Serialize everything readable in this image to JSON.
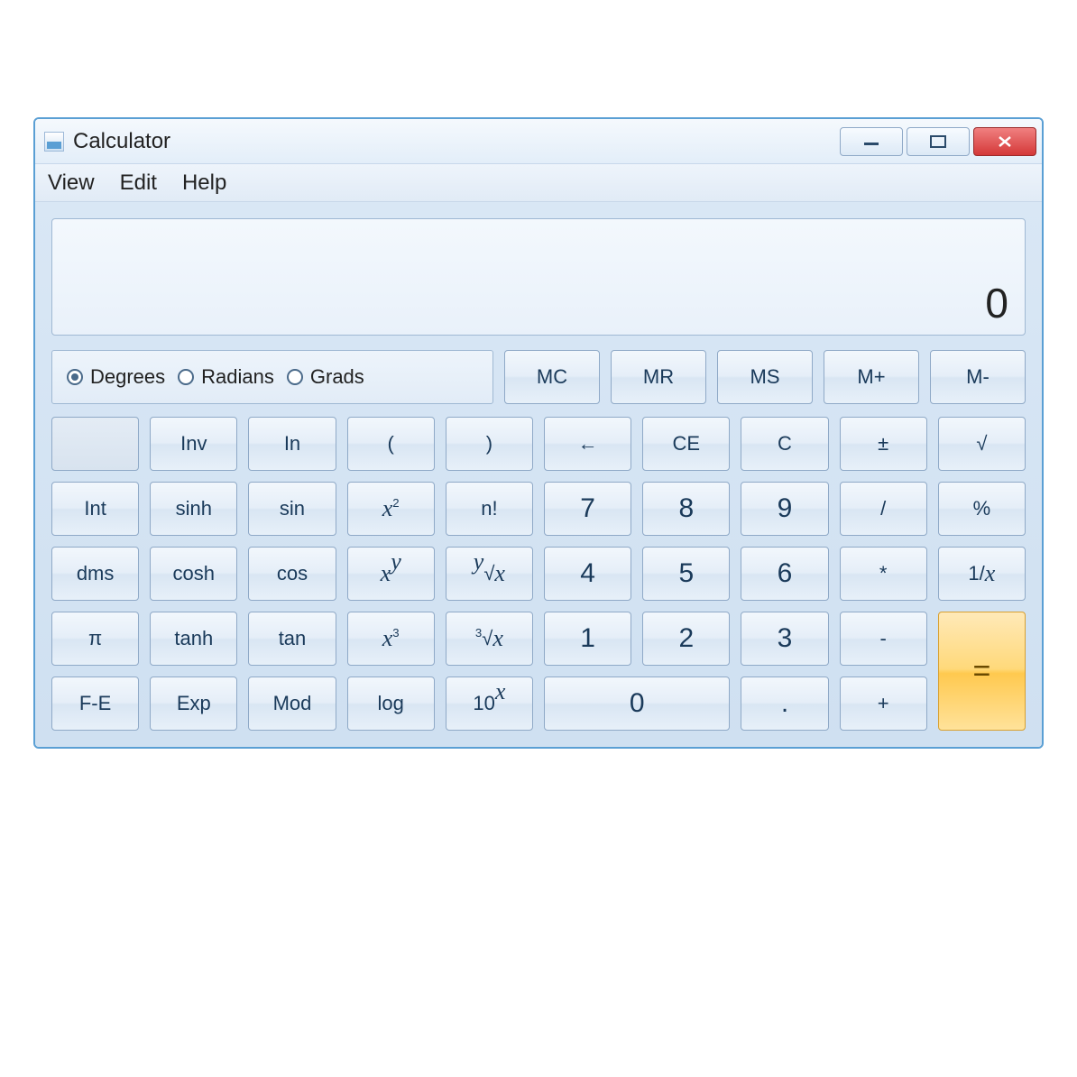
{
  "window": {
    "title": "Calculator"
  },
  "menu": {
    "view": "View",
    "edit": "Edit",
    "help": "Help"
  },
  "display": {
    "value": "0"
  },
  "angle": {
    "degrees": "Degrees",
    "radians": "Radians",
    "grads": "Grads",
    "selected": "degrees"
  },
  "memory": {
    "mc": "MC",
    "mr": "MR",
    "ms": "MS",
    "mplus": "M+",
    "mminus": "M-"
  },
  "keys": {
    "inv": "Inv",
    "ln": "In",
    "lparen": "(",
    "rparen": ")",
    "back": "←",
    "ce": "CE",
    "c": "C",
    "plusminus": "±",
    "sqrt": "√",
    "int": "Int",
    "sinh": "sinh",
    "sin": "sin",
    "fact": "n!",
    "d7": "7",
    "d8": "8",
    "d9": "9",
    "div": "/",
    "percent": "%",
    "dms": "dms",
    "cosh": "cosh",
    "cos": "cos",
    "d4": "4",
    "d5": "5",
    "d6": "6",
    "mul": "*",
    "pi": "π",
    "tanh": "tanh",
    "tan": "tan",
    "d1": "1",
    "d2": "2",
    "d3": "3",
    "sub": "-",
    "eq": "=",
    "fe": "F-E",
    "exp": "Exp",
    "mod": "Mod",
    "log": "log",
    "d0": "0",
    "dot": ".",
    "add": "+",
    "x2_base": "x",
    "x2_exp": "2",
    "xy_base": "x",
    "xy_exp": "y",
    "x3_base": "x",
    "x3_exp": "3",
    "yroot_y": "y",
    "yroot_x": "x",
    "cubert_3": "3",
    "cubert_x": "x",
    "tenx_base": "10",
    "tenx_exp": "x",
    "recip_1": "1",
    "recip_x": "x"
  }
}
